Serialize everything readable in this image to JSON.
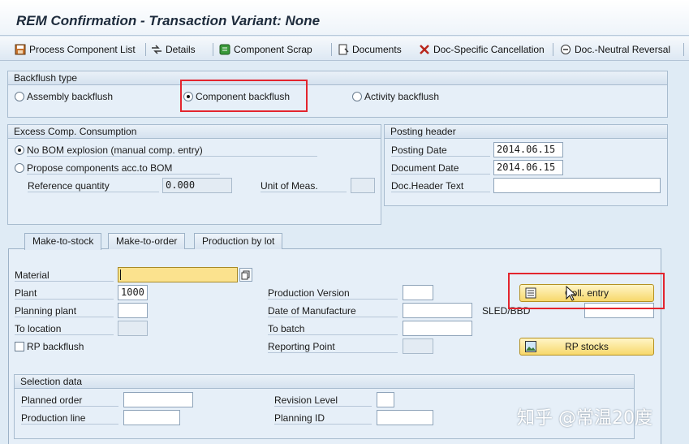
{
  "window": {
    "title": "REM Confirmation - Transaction Variant: None"
  },
  "toolbar": {
    "items": [
      {
        "label": "Process Component List",
        "icon": "save-list-icon"
      },
      {
        "label": "Details",
        "icon": "details-arrows-icon"
      },
      {
        "label": "Component Scrap",
        "icon": "component-scrap-icon"
      },
      {
        "label": "Documents",
        "icon": "documents-icon"
      },
      {
        "label": "Doc-Specific Cancellation",
        "icon": "cancel-tool-icon"
      },
      {
        "label": "Doc.-Neutral Reversal",
        "icon": "reversal-icon"
      }
    ]
  },
  "backflush_type": {
    "title": "Backflush type",
    "options": [
      {
        "label": "Assembly backflush",
        "selected": false
      },
      {
        "label": "Component backflush",
        "selected": true
      },
      {
        "label": "Activity backflush",
        "selected": false
      }
    ],
    "highlight_color": "#e3252e"
  },
  "excess_comp": {
    "title": "Excess Comp. Consumption",
    "options": [
      {
        "label": "No BOM explosion (manual comp. entry)",
        "selected": true
      },
      {
        "label": "Propose components acc.to BOM",
        "selected": false
      }
    ],
    "reference_quantity_label": "Reference quantity",
    "reference_quantity_value": "0.000",
    "unit_label": "Unit of Meas.",
    "unit_value": ""
  },
  "posting_header": {
    "title": "Posting header",
    "posting_date_label": "Posting Date",
    "posting_date": "2014.06.15",
    "document_date_label": "Document Date",
    "document_date": "2014.06.15",
    "doc_header_text_label": "Doc.Header Text",
    "doc_header_text": ""
  },
  "tabs": [
    {
      "label": "Make-to-stock",
      "active": true
    },
    {
      "label": "Make-to-order",
      "active": false
    },
    {
      "label": "Production by lot",
      "active": false
    }
  ],
  "form": {
    "material_label": "Material",
    "material": "",
    "plant_label": "Plant",
    "plant": "1000",
    "planning_plant_label": "Planning plant",
    "planning_plant": "",
    "to_location_label": "To location",
    "to_location": "",
    "rp_backflush_label": "RP backflush",
    "rp_backflush": false,
    "production_version_label": "Production Version",
    "production_version": "",
    "date_of_manufacture_label": "Date of Manufacture",
    "date_of_manufacture": "",
    "to_batch_label": "To batch",
    "to_batch": "",
    "reporting_point_label": "Reporting Point",
    "reporting_point": "",
    "sled_label": "SLED/BBD",
    "sled": "",
    "coll_entry_button": "Coll. entry",
    "rp_stocks_button": "RP stocks"
  },
  "selection_data": {
    "title": "Selection data",
    "planned_order_label": "Planned order",
    "planned_order": "",
    "production_line_label": "Production line",
    "production_line": "",
    "revision_level_label": "Revision Level",
    "revision_level": "",
    "planning_id_label": "Planning ID",
    "planning_id": ""
  },
  "watermark": "知乎 @常温20度"
}
